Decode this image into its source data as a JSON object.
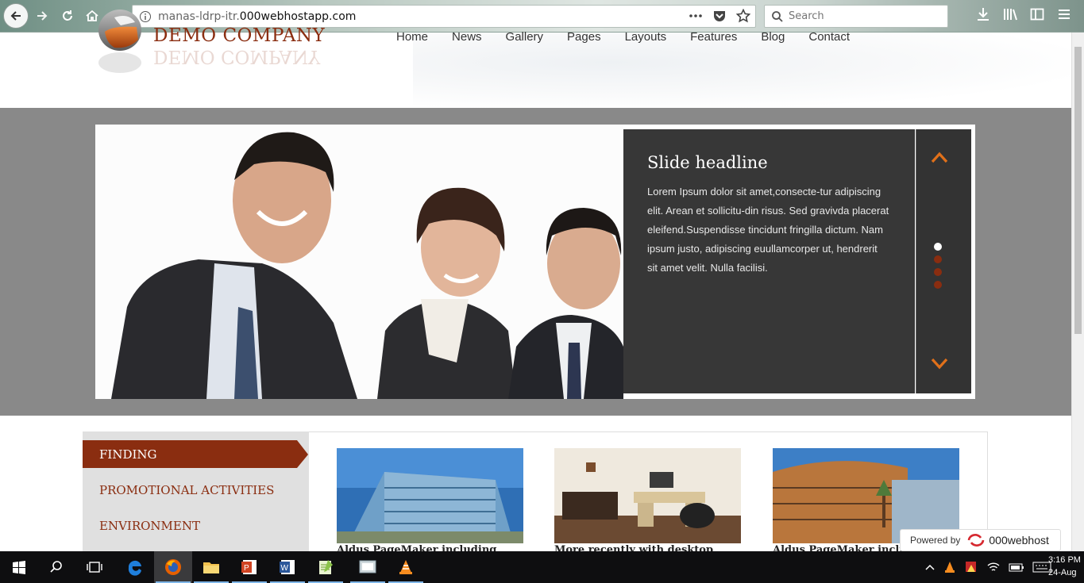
{
  "browser": {
    "url_prefix": "manas-ldrp-itr.",
    "url_domain": "000webhostapp.com",
    "search_placeholder": "Search"
  },
  "site": {
    "brand": "DEMO COMPANY",
    "nav": [
      "Home",
      "News",
      "Gallery",
      "Pages",
      "Layouts",
      "Features",
      "Blog",
      "Contact"
    ]
  },
  "slide": {
    "headline": "Slide headline",
    "body": "Lorem Ipsum dolor sit amet,consecte-tur adipiscing elit. Arean et sollicitu-din risus. Sed gravivda placerat eleifend.Suspendisse tincidunt fringilla dictum. Nam ipsum justo, adipiscing euullamcorper ut, hendrerit sit amet velit. Nulla facilisi.",
    "dot_count": 4,
    "active_dot": 0
  },
  "sidebar": {
    "items": [
      {
        "label": "FINDING",
        "active": true
      },
      {
        "label": "PROMOTIONAL ACTIVITIES",
        "active": false
      },
      {
        "label": "ENVIRONMENT",
        "active": false
      }
    ]
  },
  "thumbnails": [
    {
      "caption": "Aldus PageMaker including"
    },
    {
      "caption": "More recently with desktop"
    },
    {
      "caption": "Aldus PageMaker including"
    }
  ],
  "powered": {
    "label": "Powered by",
    "brand": "000webhost"
  },
  "taskbar": {
    "time": "3:16 PM",
    "date": "24-Aug"
  },
  "colors": {
    "accent": "#8a2d10",
    "orange": "#e0701a",
    "hero_band": "#898989"
  }
}
